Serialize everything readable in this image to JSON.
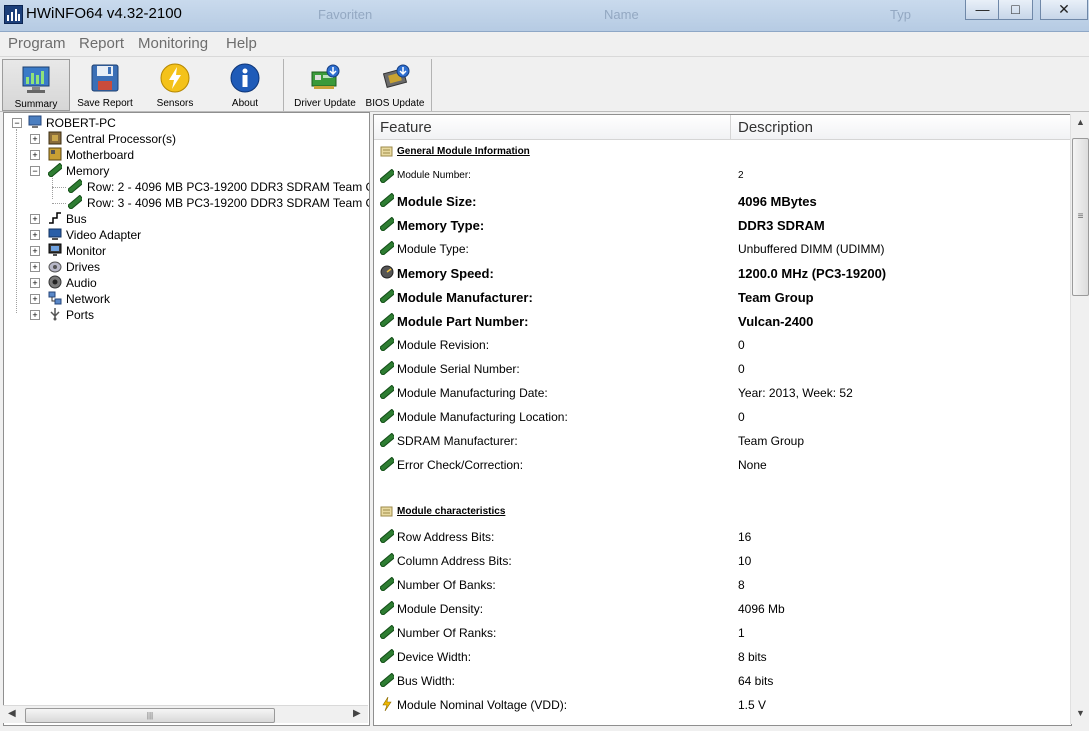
{
  "window": {
    "title": "HWiNFO64 v4.32-2100",
    "background_ghost": [
      "Favoriten",
      "Name",
      "Typ"
    ],
    "minimize_glyph": "—",
    "maximize_glyph": "□",
    "close_glyph": "✕"
  },
  "menu": [
    "Program",
    "Report",
    "Monitoring",
    "Help"
  ],
  "toolbar": {
    "summary": "Summary",
    "save_report": "Save Report",
    "sensors": "Sensors",
    "about": "About",
    "driver_update": "Driver Update",
    "bios_update": "BIOS Update"
  },
  "tree": {
    "root": "ROBERT-PC",
    "items": [
      "Central Processor(s)",
      "Motherboard",
      "Memory",
      "Row: 2 - 4096 MB PC3-19200 DDR3 SDRAM Team G",
      "Row: 3 - 4096 MB PC3-19200 DDR3 SDRAM Team G",
      "Bus",
      "Video Adapter",
      "Monitor",
      "Drives",
      "Audio",
      "Network",
      "Ports"
    ],
    "plus": "+",
    "minus": "−"
  },
  "details": {
    "col_feature": "Feature",
    "col_description": "Description",
    "rows": [
      {
        "feature": "General Module Information",
        "description": ""
      },
      {
        "feature": "Module Number:",
        "description": "2"
      },
      {
        "feature": "Module Size:",
        "description": "4096 MBytes"
      },
      {
        "feature": "Memory Type:",
        "description": "DDR3 SDRAM"
      },
      {
        "feature": "Module Type:",
        "description": "Unbuffered DIMM (UDIMM)"
      },
      {
        "feature": "Memory Speed:",
        "description": "1200.0 MHz (PC3-19200)"
      },
      {
        "feature": "Module Manufacturer:",
        "description": "Team Group"
      },
      {
        "feature": "Module Part Number:",
        "description": "Vulcan-2400"
      },
      {
        "feature": "Module Revision:",
        "description": "0"
      },
      {
        "feature": "Module Serial Number:",
        "description": "0"
      },
      {
        "feature": "Module Manufacturing Date:",
        "description": "Year: 2013, Week: 52"
      },
      {
        "feature": "Module Manufacturing Location:",
        "description": "0"
      },
      {
        "feature": "SDRAM Manufacturer:",
        "description": "Team Group"
      },
      {
        "feature": "Error Check/Correction:",
        "description": "None"
      },
      {
        "feature": "Module characteristics",
        "description": ""
      },
      {
        "feature": "Row Address Bits:",
        "description": "16"
      },
      {
        "feature": "Column Address Bits:",
        "description": "10"
      },
      {
        "feature": "Number Of Banks:",
        "description": "8"
      },
      {
        "feature": "Module Density:",
        "description": "4096 Mb"
      },
      {
        "feature": "Number Of Ranks:",
        "description": "1"
      },
      {
        "feature": "Device Width:",
        "description": "8 bits"
      },
      {
        "feature": "Bus Width:",
        "description": "64 bits"
      },
      {
        "feature": "Module Nominal Voltage (VDD):",
        "description": "1.5 V"
      }
    ]
  },
  "scroll": {
    "up": "▲",
    "down": "▼",
    "left": "◀",
    "right": "▶",
    "grip": "|||",
    "vgrip": "≡"
  },
  "colors": {
    "memory_icon": "#2e7d32",
    "section_icon": "#e8d9a0",
    "accent": "#1c3f7a"
  }
}
